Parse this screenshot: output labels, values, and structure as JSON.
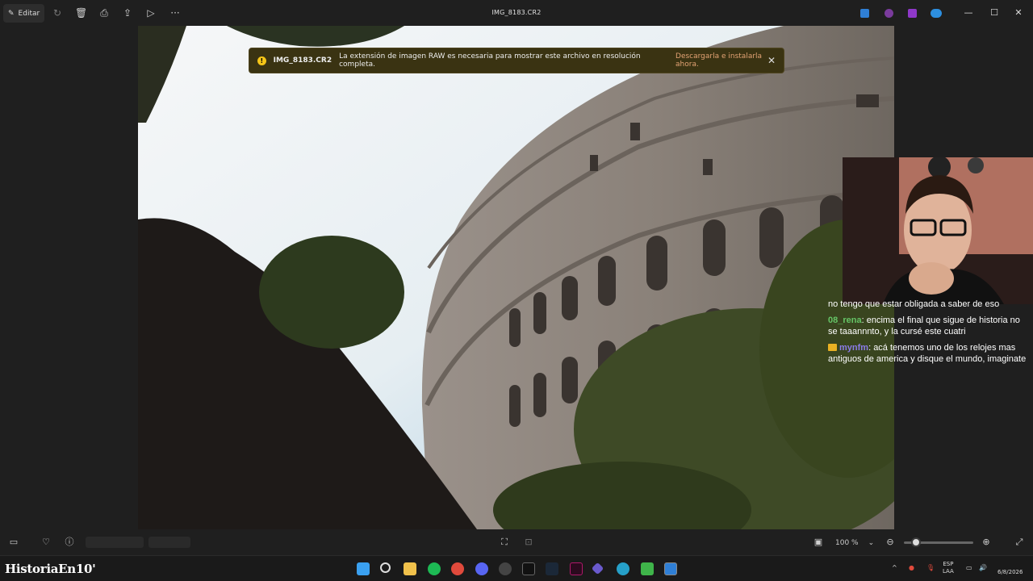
{
  "titlebar": {
    "edit_label": "Editar",
    "file_name": "IMG_8183.CR2",
    "icons": [
      "rotate-icon",
      "delete-icon",
      "print-icon",
      "share-icon",
      "slideshow-icon",
      "more-icon"
    ]
  },
  "banner": {
    "file": "IMG_8183.CR2",
    "message": "La extensión de imagen RAW es necesaria para mostrar este archivo en resolución completa.",
    "link": "Descargarla e instalarla ahora.",
    "close_icon": "close-icon"
  },
  "chat": {
    "lines": [
      {
        "user": "",
        "text": "no tengo que estar obligada a saber de eso"
      },
      {
        "user": "08_rena",
        "text": "encima el final que sigue de historia no se taaannnto, y la cursé este cuatri"
      },
      {
        "user": "mynfm",
        "text": "acá tenemos uno de los relojes mas antiguos de america y disque el mundo, imaginate"
      }
    ]
  },
  "bottombar": {
    "zoom": "100 %"
  },
  "taskbar": {
    "brand": "HistoriaEn10'",
    "lang_top": "ESP",
    "lang_bottom": "LAA",
    "date": "6/8/2026"
  },
  "colors": {
    "banner_bg": "#3a3312",
    "warning": "#f5c518",
    "link": "#e3a374",
    "user1": "#65c466",
    "user2": "#8a7be8"
  }
}
